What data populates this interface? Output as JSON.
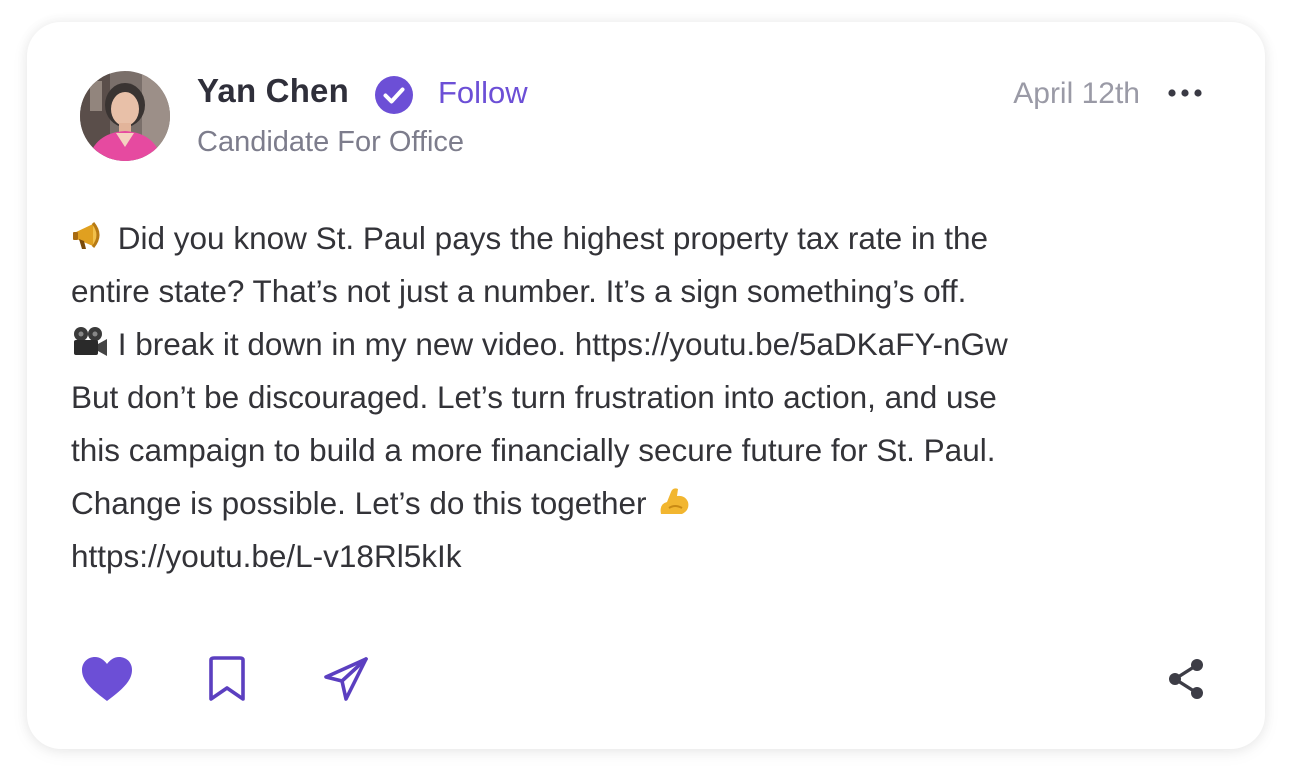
{
  "post": {
    "author": {
      "name": "Yan Chen",
      "verified": true,
      "follow_label": "Follow",
      "subtitle": "Candidate For Office",
      "avatar_icon": "avatar-photo"
    },
    "date": "April 12th",
    "more_icon": "more-horizontal-icon",
    "lines": [
      {
        "icon": "megaphone-icon",
        "text": "Did you know St. Paul pays the highest property tax rate in the"
      },
      {
        "text": "entire state? That’s not just a number. It’s a sign something’s off."
      },
      {
        "icon": "movie-camera-icon",
        "text": "I break it down in my new video. https://youtu.be/5aDKaFY-nGw"
      },
      {
        "text": "But don’t be discouraged. Let’s turn frustration into action, and use"
      },
      {
        "text": "this campaign to build a more financially secure future for St. Paul."
      },
      {
        "text": "Change is possible. Let’s do this together",
        "trailing_icon": "flexed-biceps-icon"
      },
      {
        "text": "https://youtu.be/L-v18Rl5kIk"
      }
    ],
    "actions": {
      "like_icon": "heart-icon",
      "liked": true,
      "bookmark_icon": "bookmark-icon",
      "send_icon": "send-icon",
      "share_icon": "share-icon"
    }
  },
  "colors": {
    "accent": "#6c4fd6",
    "text_primary": "#2f2f3a",
    "text_body": "#333338",
    "text_muted": "#7d7d8c",
    "date": "#9a9aa6",
    "card_bg": "#ffffff"
  }
}
